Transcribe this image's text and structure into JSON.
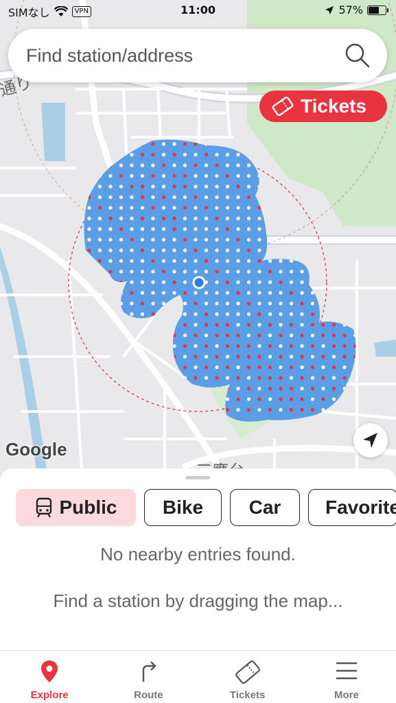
{
  "status_bar": {
    "carrier": "SIMなし",
    "vpn": "VPN",
    "time": "11:00",
    "battery_percent": "57%",
    "battery_level": 0.57
  },
  "search": {
    "placeholder": "Find station/address"
  },
  "tickets_button": {
    "label": "Tickets"
  },
  "map": {
    "attribution": "Google",
    "labels": [
      "通り",
      "三鷹台"
    ]
  },
  "colors": {
    "accent": "#e8343f",
    "active_mode_bg": "#fadadd",
    "coverage_fill": "#5b9ee6",
    "dot_red": "#e8343f",
    "dot_white": "#ffffff",
    "map_bg": "#e9e9ec",
    "park": "#cfe8c7",
    "water": "#a9cfe6"
  },
  "modes": [
    {
      "label": "Public",
      "icon": "train-icon",
      "active": true
    },
    {
      "label": "Bike",
      "active": false
    },
    {
      "label": "Car",
      "active": false
    },
    {
      "label": "Favorites",
      "active": false
    }
  ],
  "empty_state": {
    "message": "No nearby entries found.",
    "hint": "Find a station by dragging the map..."
  },
  "tabs": [
    {
      "label": "Explore",
      "icon": "location-pin-icon",
      "active": true
    },
    {
      "label": "Route",
      "icon": "route-arrow-icon",
      "active": false
    },
    {
      "label": "Tickets",
      "icon": "ticket-icon",
      "active": false
    },
    {
      "label": "More",
      "icon": "menu-icon",
      "active": false
    }
  ]
}
